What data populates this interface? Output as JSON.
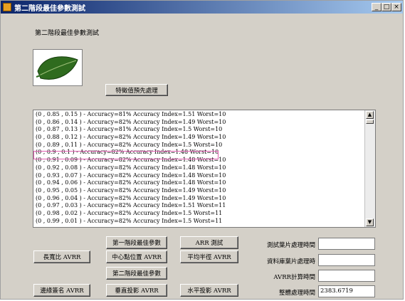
{
  "window": {
    "title": "第二階段最佳參數測試",
    "min_glyph": "_",
    "max_glyph": "□",
    "close_glyph": "×"
  },
  "heading": "第二階段最佳參數測試",
  "buttons": {
    "feature_preprocess": "特徵值預先處理",
    "stage1_best": "第一階段最佳參數",
    "arr_test": "ARR 測試",
    "aspect_ratio": "長寬比 AVRR",
    "center_position": "中心點位置 AVRR",
    "avg_radius": "平均半徑 AVRR",
    "stage2_best": "第二階段最佳參數",
    "edge_signature": "邊緣簽名 AVRR",
    "vertical_projection": "垂直投影 AVRR",
    "horizontal_projection": "水平投影 AVRR"
  },
  "results": [
    "(0 , 0.85 , 0.15 ) - Accuracy=81%   Accuracy Index=1.51   Worst=10",
    "(0 , 0.86 , 0.14 ) - Accuracy=82%   Accuracy Index=1.49   Worst=10",
    "(0 , 0.87 , 0.13 ) - Accuracy=81%   Accuracy Index=1.5   Worst=10",
    "(0 , 0.88 , 0.12 ) - Accuracy=82%   Accuracy Index=1.49   Worst=10",
    "(0 , 0.89 , 0.11 ) - Accuracy=82%   Accuracy Index=1.5   Worst=10",
    "(0 , 0.9 , 0.1 ) - Accuracy=82%   Accuracy Index=1.48   Worst=10",
    "(0 , 0.91 , 0.09 ) - Accuracy=82%   Accuracy Index=1.48   Worst=10",
    "(0 , 0.92 , 0.08 ) - Accuracy=82%   Accuracy Index=1.48   Worst=10",
    "(0 , 0.93 , 0.07 ) - Accuracy=82%   Accuracy Index=1.48   Worst=10",
    "(0 , 0.94 , 0.06 ) - Accuracy=82%   Accuracy Index=1.48   Worst=10",
    "(0 , 0.95 , 0.05 ) - Accuracy=82%   Accuracy Index=1.49   Worst=10",
    "(0 , 0.96 , 0.04 ) - Accuracy=82%   Accuracy Index=1.49   Worst=10",
    "(0 , 0.97 , 0.03 ) - Accuracy=82%   Accuracy Index=1.51   Worst=11",
    "(0 , 0.98 , 0.02 ) - Accuracy=82%   Accuracy Index=1.5   Worst=11",
    "(0 , 0.99 , 0.01 ) - Accuracy=82%   Accuracy Index=1.5   Worst=11"
  ],
  "highlighted_row": 5,
  "fields": {
    "test_image_time_label": "測試葉片處理時間",
    "test_image_time_value": "",
    "db_image_time_label": "資料庫葉片處理時",
    "db_image_time_value": "",
    "avrr_time_label": "AVRR計算時間",
    "avrr_time_value": "",
    "total_time_label": "整體處理時間",
    "total_time_value": "2383.6719"
  },
  "colors": {
    "title_start": "#0a246a",
    "title_end": "#a6caf0",
    "highlight": "#e060b0",
    "leaf": "#2f6b1e"
  },
  "icons": {
    "scroll_up": "▲",
    "scroll_down": "▼"
  }
}
